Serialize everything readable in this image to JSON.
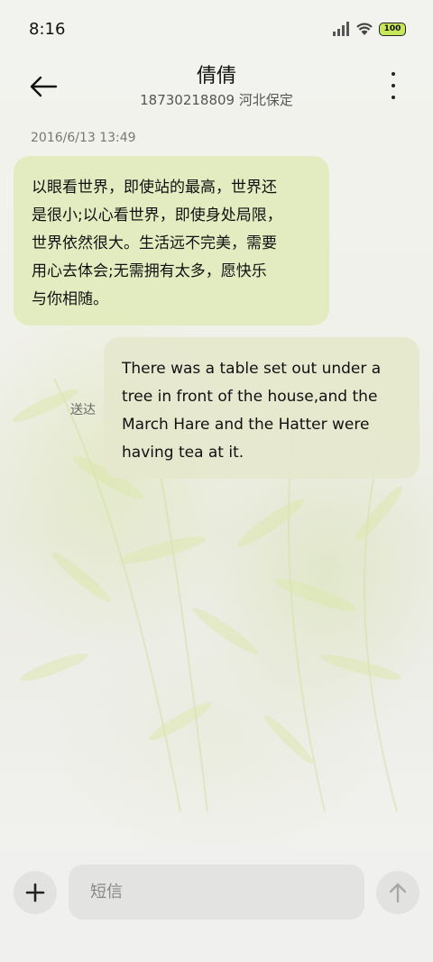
{
  "status_bar": {
    "time": "8:16",
    "battery": "100"
  },
  "header": {
    "contact_name": "倩倩",
    "contact_detail": "18730218809 河北保定"
  },
  "conversation": {
    "timestamp": "2016/6/13 13:49",
    "messages": [
      {
        "direction": "incoming",
        "lines": [
          "以眼看世界，即使站的最高，世界还",
          "是很小;以心看世界，即使身处局限，",
          "世界依然很大。生活远不完美，需要",
          "用心去体会;无需拥有太多，愿快乐",
          "与你相随。"
        ]
      },
      {
        "direction": "outgoing",
        "status": "送达",
        "lines": [
          "There was a table set out under a",
          "tree in front of the house,and the",
          "March Hare and the Hatter were",
          "having tea at it."
        ]
      }
    ]
  },
  "composer": {
    "placeholder": "短信"
  },
  "colors": {
    "incoming_bubble": "#e2ecbc",
    "outgoing_bubble": "#e6e8ce",
    "battery_fill": "#c7e65a"
  }
}
